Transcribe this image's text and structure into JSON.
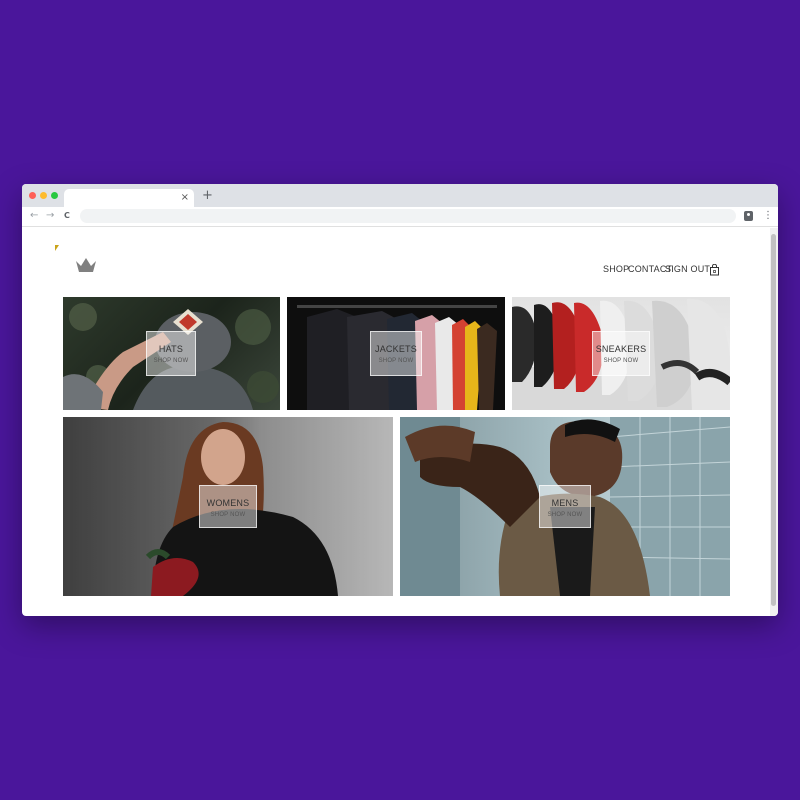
{
  "browser": {
    "tab_close": "×",
    "new_tab": "+",
    "back": "←",
    "forward": "→",
    "reload": "C",
    "menu": "⋮"
  },
  "site": {
    "logo_icon": "crown-icon",
    "nav": [
      "SHOP",
      "CONTACT",
      "SIGN OUT"
    ],
    "cart_icon": "shopping-bag-icon",
    "categories": [
      {
        "title": "HATS",
        "cta": "SHOP NOW"
      },
      {
        "title": "JACKETS",
        "cta": "SHOP NOW"
      },
      {
        "title": "SNEAKERS",
        "cta": "SHOP NOW"
      },
      {
        "title": "WOMENS",
        "cta": "SHOP NOW"
      },
      {
        "title": "MENS",
        "cta": "SHOP NOW"
      }
    ]
  },
  "colors": {
    "background": "#4a169b",
    "window": "#ffffff",
    "tabbar": "#dee1e6"
  }
}
